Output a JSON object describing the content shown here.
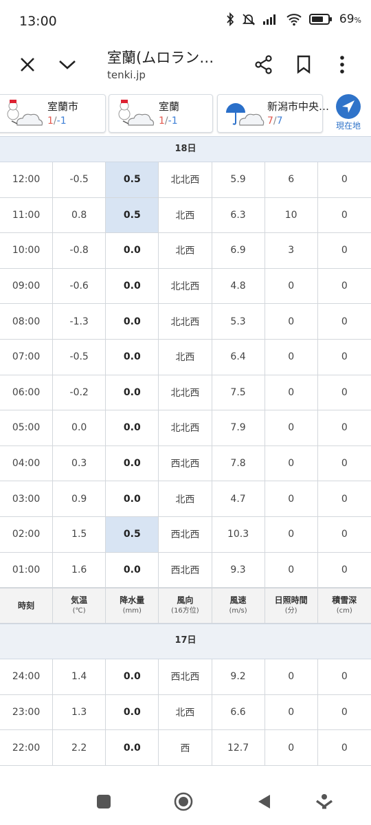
{
  "status": {
    "time": "13:00",
    "battery": "69",
    "battery_unit": "%"
  },
  "toolbar": {
    "title": "室蘭(ムロラン…",
    "url": "tenki.jp"
  },
  "cards": [
    {
      "name": "室蘭市",
      "hi": "1",
      "sep": "/",
      "lo": "-1"
    },
    {
      "name": "室蘭",
      "hi": "1",
      "sep": "/",
      "lo": "-1"
    },
    {
      "name": "新潟市中央…",
      "hi": "7",
      "sep": "/",
      "lo": "7"
    }
  ],
  "here_label": "現在地",
  "day1": "18日",
  "day2": "17日",
  "rows_day1": [
    {
      "time": "12:00",
      "temp": "-0.5",
      "precip": "0.5",
      "dir": "北北西",
      "speed": "5.9",
      "sun": "6",
      "snow": "0",
      "hl": true
    },
    {
      "time": "11:00",
      "temp": "0.8",
      "precip": "0.5",
      "dir": "北西",
      "speed": "6.3",
      "sun": "10",
      "snow": "0",
      "hl": true
    },
    {
      "time": "10:00",
      "temp": "-0.8",
      "precip": "0.0",
      "dir": "北西",
      "speed": "6.9",
      "sun": "3",
      "snow": "0",
      "hl": false
    },
    {
      "time": "09:00",
      "temp": "-0.6",
      "precip": "0.0",
      "dir": "北北西",
      "speed": "4.8",
      "sun": "0",
      "snow": "0",
      "hl": false
    },
    {
      "time": "08:00",
      "temp": "-1.3",
      "precip": "0.0",
      "dir": "北北西",
      "speed": "5.3",
      "sun": "0",
      "snow": "0",
      "hl": false
    },
    {
      "time": "07:00",
      "temp": "-0.5",
      "precip": "0.0",
      "dir": "北西",
      "speed": "6.4",
      "sun": "0",
      "snow": "0",
      "hl": false
    },
    {
      "time": "06:00",
      "temp": "-0.2",
      "precip": "0.0",
      "dir": "北北西",
      "speed": "7.5",
      "sun": "0",
      "snow": "0",
      "hl": false
    },
    {
      "time": "05:00",
      "temp": "0.0",
      "precip": "0.0",
      "dir": "北北西",
      "speed": "7.9",
      "sun": "0",
      "snow": "0",
      "hl": false
    },
    {
      "time": "04:00",
      "temp": "0.3",
      "precip": "0.0",
      "dir": "西北西",
      "speed": "7.8",
      "sun": "0",
      "snow": "0",
      "hl": false
    },
    {
      "time": "03:00",
      "temp": "0.9",
      "precip": "0.0",
      "dir": "北西",
      "speed": "4.7",
      "sun": "0",
      "snow": "0",
      "hl": false
    },
    {
      "time": "02:00",
      "temp": "1.5",
      "precip": "0.5",
      "dir": "西北西",
      "speed": "10.3",
      "sun": "0",
      "snow": "0",
      "hl": true
    },
    {
      "time": "01:00",
      "temp": "1.6",
      "precip": "0.0",
      "dir": "西北西",
      "speed": "9.3",
      "sun": "0",
      "snow": "0",
      "hl": false
    }
  ],
  "header": [
    {
      "label": "時刻",
      "unit": ""
    },
    {
      "label": "気温",
      "unit": "(℃)"
    },
    {
      "label": "降水量",
      "unit": "(mm)"
    },
    {
      "label": "風向",
      "unit": "(16方位)"
    },
    {
      "label": "風速",
      "unit": "(m/s)"
    },
    {
      "label": "日照時間",
      "unit": "(分)"
    },
    {
      "label": "積雪深",
      "unit": "(cm)"
    }
  ],
  "rows_day2": [
    {
      "time": "24:00",
      "temp": "1.4",
      "precip": "0.0",
      "dir": "西北西",
      "speed": "9.2",
      "sun": "0",
      "snow": "0",
      "hl": false
    },
    {
      "time": "23:00",
      "temp": "1.3",
      "precip": "0.0",
      "dir": "北西",
      "speed": "6.6",
      "sun": "0",
      "snow": "0",
      "hl": false
    },
    {
      "time": "22:00",
      "temp": "2.2",
      "precip": "0.0",
      "dir": "西",
      "speed": "12.7",
      "sun": "0",
      "snow": "0",
      "hl": false
    }
  ],
  "colors": {
    "accent": "#2f73c9",
    "highlight": "#d8e4f3",
    "temp_hi": "#e2574c",
    "temp_lo": "#3d7fd6"
  }
}
